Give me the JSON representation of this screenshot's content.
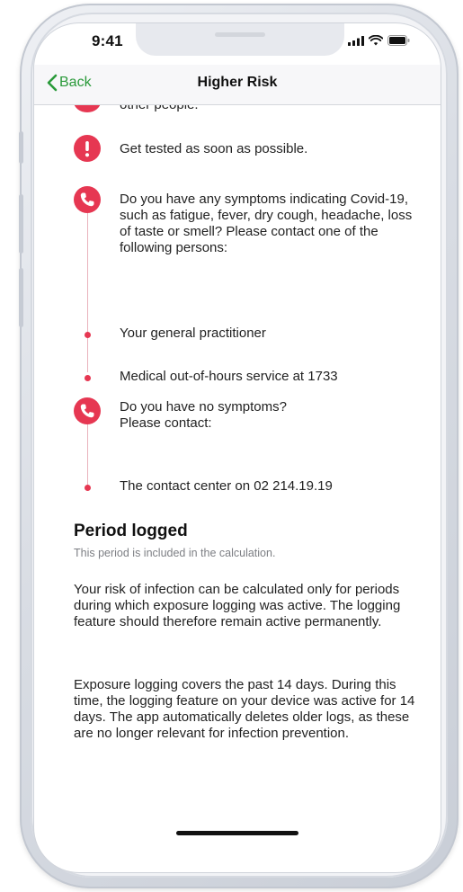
{
  "status_bar": {
    "time": "9:41"
  },
  "navbar": {
    "back_label": "Back",
    "title": "Higher Risk"
  },
  "steps": {
    "clipped_text": "other people.",
    "get_tested": "Get tested as soon as possible.",
    "symptoms_question": "Do you have any symptoms indicating Covid-19, such as fatigue, fever, dry cough, headache, loss of taste or smell? Please contact one of the following persons:",
    "contact_gp": "Your general practitioner",
    "contact_medical": "Medical out-of-hours service at 1733",
    "no_symptoms_question": "Do you have no symptoms? Please contact:",
    "contact_center": "The contact center on 02 214.19.19"
  },
  "period_section": {
    "title": "Period logged",
    "subtitle": "This period is included in the calculation.",
    "paragraph_1": "Your risk of infection can be calculated only for periods during which exposure logging was active. The logging feature should therefore remain active permanently.",
    "paragraph_2": "Exposure logging covers the past 14 days. During this time, the logging feature on your device was active for 14 days. The app automatically deletes older logs, as these are no longer relevant for infection prevention."
  },
  "colors": {
    "accent_green": "#2a9a3a",
    "alert_red": "#e63752"
  },
  "icons": {
    "alert": "exclamation-circle-icon",
    "phone": "phone-icon",
    "back": "chevron-left-icon"
  }
}
